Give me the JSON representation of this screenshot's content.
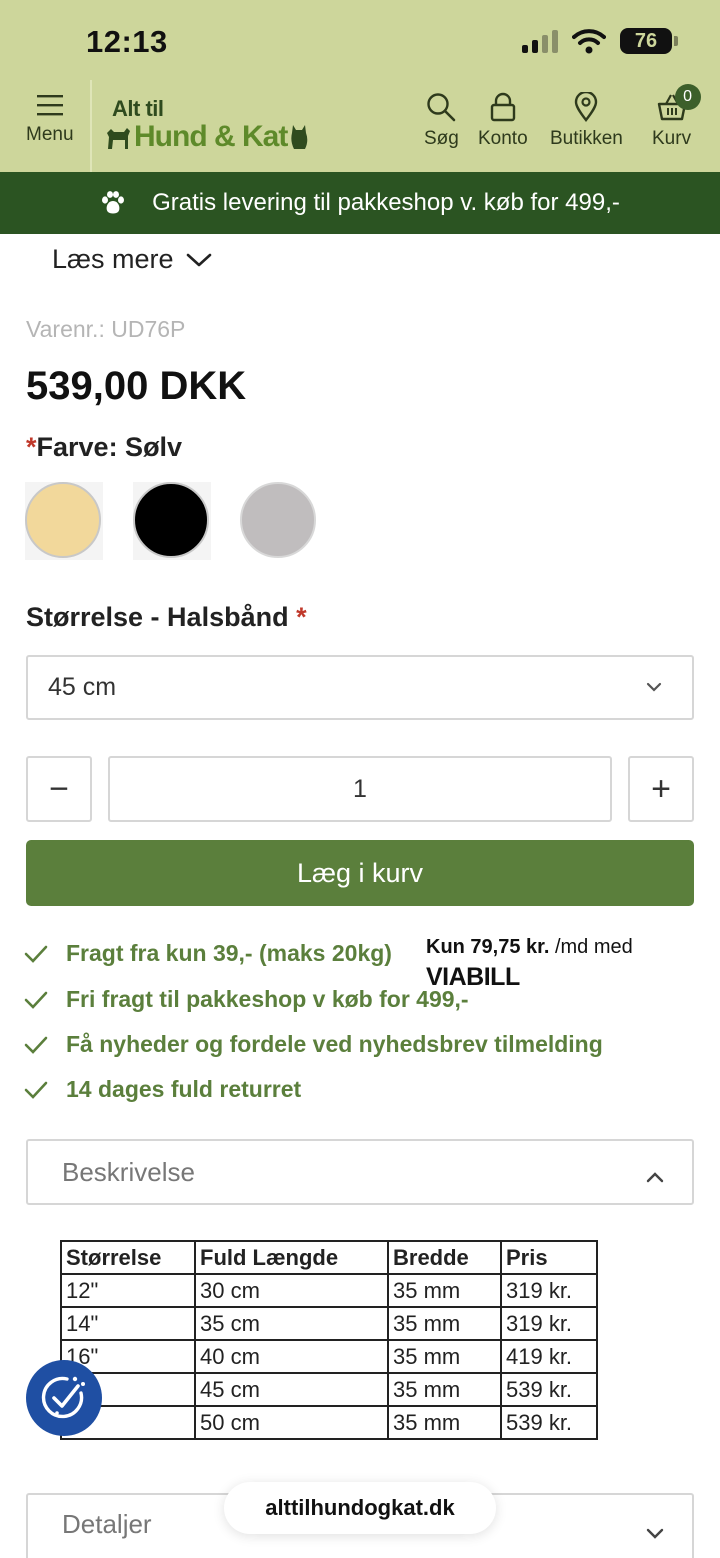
{
  "status_bar": {
    "time": "12:13",
    "battery": "76"
  },
  "header": {
    "menu_label": "Menu",
    "logo_top": "Alt til",
    "logo_bottom": "Hund & Kat",
    "search_label": "Søg",
    "account_label": "Konto",
    "store_label": "Butikken",
    "cart_label": "Kurv",
    "cart_count": "0"
  },
  "promo": {
    "text": "Gratis levering til pakkeshop v. køb for 499,-"
  },
  "product": {
    "read_more": "Læs mere",
    "sku": "Varenr.: UD76P",
    "price": "539,00 DKK",
    "required_mark": "*",
    "color_label": "Farve: Sølv",
    "swatches": [
      {
        "name": "beige",
        "color": "#f2d89b"
      },
      {
        "name": "black",
        "color": "#000000"
      },
      {
        "name": "silver",
        "color": "#c0bdbe"
      }
    ],
    "size_label": "Størrelse - Halsbånd",
    "size_selected": "45 cm",
    "qty_minus": "−",
    "qty_value": "1",
    "qty_plus": "+",
    "add_to_cart": "Læg i kurv"
  },
  "usps": [
    "Fragt fra kun 39,- (maks 20kg)",
    "Fri fragt til pakkeshop v køb for 499,-",
    "Få nyheder og fordele ved nyhedsbrev tilmelding",
    "14 dages fuld returret"
  ],
  "viabill": {
    "amount": "Kun 79,75 kr.",
    "suffix": " /md med",
    "logo": "VIABILL"
  },
  "description": {
    "title": "Beskrivelse",
    "table": {
      "headers": [
        "Størrelse",
        "Fuld Længde",
        "Bredde",
        "Pris"
      ],
      "rows": [
        [
          "12\"",
          "30 cm",
          "35 mm",
          "319 kr."
        ],
        [
          "14\"",
          "35 cm",
          "35 mm",
          "319 kr."
        ],
        [
          "16\"",
          "40 cm",
          "35 mm",
          "419 kr."
        ],
        [
          "",
          "45 cm",
          "35 mm",
          "539 kr."
        ],
        [
          "",
          "50 cm",
          "35 mm",
          "539 kr."
        ]
      ]
    }
  },
  "details": {
    "title": "Detaljer"
  },
  "browser": {
    "url": "alttilhundogkat.dk"
  },
  "colors": {
    "header_bg": "#cdd69b",
    "promo_bg": "#2b5422",
    "accent": "#5b7f3c"
  }
}
